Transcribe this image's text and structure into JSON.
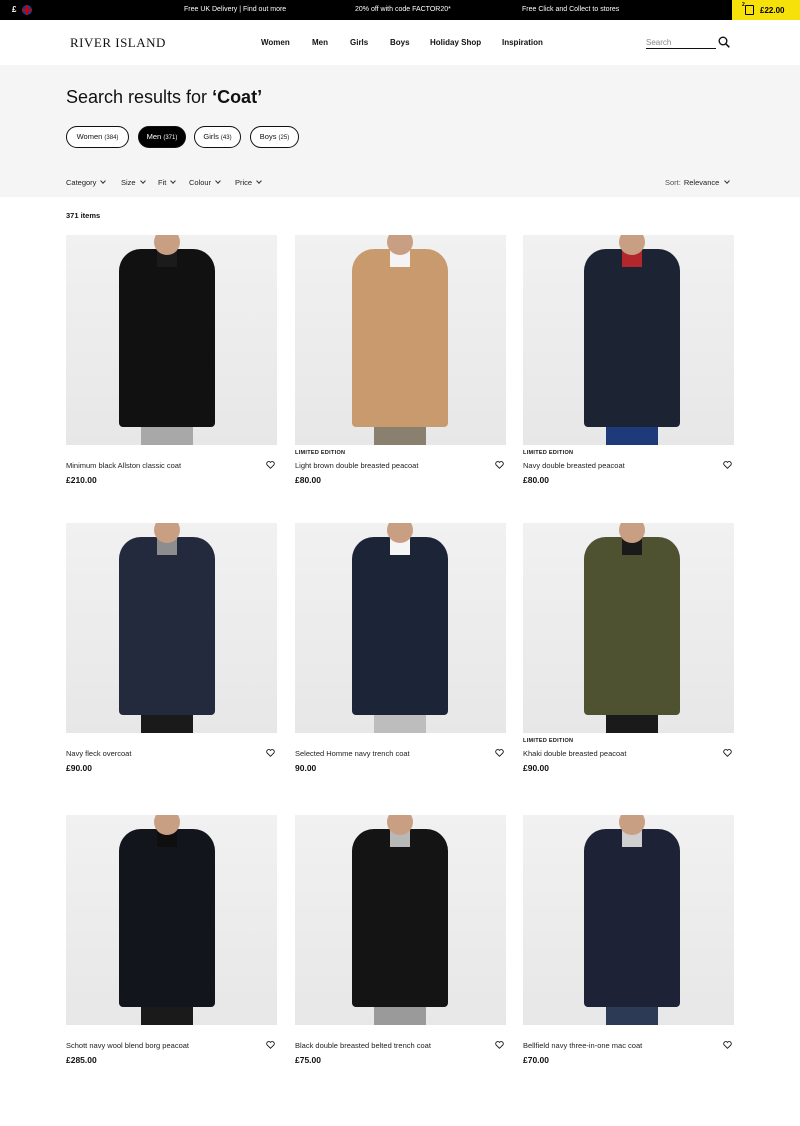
{
  "promo": {
    "currency": "£",
    "messages": [
      "Free UK Delivery | Find out more",
      "20% off with code FACTOR20*",
      "Free Click and Collect to stores"
    ],
    "bag_count": "2",
    "bag_total": "£22.00"
  },
  "header": {
    "logo": "RIVER ISLAND",
    "nav": [
      "Women",
      "Men",
      "Girls",
      "Boys",
      "Holiday Shop",
      "Inspiration"
    ],
    "search_placeholder": "Search"
  },
  "search": {
    "title_prefix": "Search results for ",
    "query": "‘Coat’",
    "pills": [
      {
        "label": "Women",
        "count": "(384)",
        "active": false
      },
      {
        "label": "Men",
        "count": "(371)",
        "active": true
      },
      {
        "label": "Girls",
        "count": "(43)",
        "active": false
      },
      {
        "label": "Boys",
        "count": "(25)",
        "active": false
      }
    ],
    "filters": [
      "Category",
      "Size",
      "Fit",
      "Colour",
      "Price"
    ],
    "sort_label": "Sort:",
    "sort_value": "Relevance"
  },
  "results_count": "371 items",
  "products": [
    {
      "badge": "",
      "name": "Minimum black Allston classic coat",
      "price": "£210.00",
      "coat_color": "#111111",
      "inner_color": "#1b1b1b",
      "legs_color": "#a8a8a8"
    },
    {
      "badge": "LIMITED EDITION",
      "name": "Light brown double breasted peacoat",
      "price": "£80.00",
      "coat_color": "#c99a6e",
      "inner_color": "#f4f4f4",
      "legs_color": "#8a8070"
    },
    {
      "badge": "LIMITED EDITION",
      "name": "Navy double breasted peacoat",
      "price": "£80.00",
      "coat_color": "#1c2333",
      "inner_color": "#b3262c",
      "legs_color": "#1f3a7a"
    },
    {
      "badge": "",
      "name": "Navy fleck overcoat",
      "price": "£90.00",
      "coat_color": "#232a3d",
      "inner_color": "#8d8d8d",
      "legs_color": "#1a1a1a"
    },
    {
      "badge": "",
      "name": "Selected Homme navy trench coat",
      "price": "90.00",
      "coat_color": "#1c2438",
      "inner_color": "#f5f5f5",
      "legs_color": "#bdbdbd"
    },
    {
      "badge": "LIMITED EDITION",
      "name": "Khaki double breasted peacoat",
      "price": "£90.00",
      "coat_color": "#4e5230",
      "inner_color": "#1a1a1a",
      "legs_color": "#1a1a1a"
    },
    {
      "badge": "",
      "name": "Schott navy wool blend borg peacoat",
      "price": "£285.00",
      "coat_color": "#12151c",
      "inner_color": "#0f0f0f",
      "legs_color": "#1a1a1a"
    },
    {
      "badge": "",
      "name": "Black double breasted belted trench coat",
      "price": "£75.00",
      "coat_color": "#141414",
      "inner_color": "#b8b8b8",
      "legs_color": "#9a9a9a"
    },
    {
      "badge": "",
      "name": "Bellfield navy three-in-one mac coat",
      "price": "£70.00",
      "coat_color": "#1d2236",
      "inner_color": "#cfcfcf",
      "legs_color": "#2d3a55"
    }
  ]
}
